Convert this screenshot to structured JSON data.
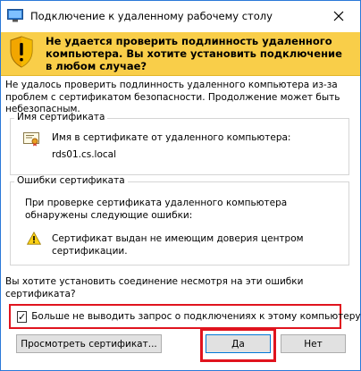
{
  "window": {
    "title": "Подключение к удаленному рабочему столу"
  },
  "banner": {
    "message": "Не удается проверить подлинность удаленного компьютера. Вы хотите установить подключение в любом случае?",
    "color": "#f9ce49"
  },
  "intro": "Не удалось проверить подлинность удаленного компьютера из-за проблем с сертификатом безопасности. Продолжение может быть небезопасным.",
  "certificate": {
    "legend": "Имя сертификата",
    "label": "Имя в сертификате от удаленного компьютера:",
    "value": "rds01.cs.local",
    "icon": "certificate-icon"
  },
  "errors": {
    "legend": "Ошибки сертификата",
    "description": "При проверке сертификата удаленного компьютера обнаружены следующие ошибки:",
    "items": [
      {
        "icon": "warning-icon",
        "text": "Сертификат выдан не имеющим доверия центром сертификации."
      }
    ]
  },
  "question": "Вы хотите установить соединение несмотря на эти ошибки сертификата?",
  "checkbox": {
    "label": "Больше не выводить запрос о подключениях к этому компьютеру",
    "checked": true,
    "check_glyph": "✓"
  },
  "buttons": {
    "view_certificate": "Просмотреть сертификат...",
    "yes": "Да",
    "no": "Нет"
  },
  "highlight_color": "#e0141e"
}
